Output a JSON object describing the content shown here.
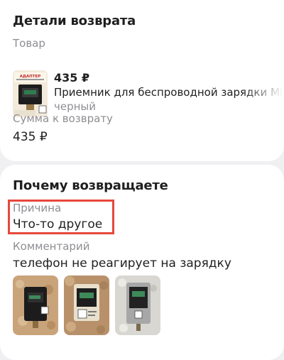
{
  "return_details": {
    "title": "Детали возврата",
    "product_label": "Товар",
    "product": {
      "price": "435 ₽",
      "name": "Приемник для беспроводной зарядки Mi",
      "variant": "черный",
      "thumb_caption": "АДАПТЕР"
    },
    "refund_label": "Сумма к возврату",
    "refund_amount": "435 ₽"
  },
  "why_return": {
    "title": "Почему возвращаете",
    "reason_label": "Причина",
    "reason_value": "Что-то другое",
    "comment_label": "Комментарий",
    "comment_value": "телефон не реагирует на зарядку",
    "photos": [
      "photo-1",
      "photo-2",
      "photo-3"
    ]
  },
  "colors": {
    "highlight_border": "#e5483b",
    "muted_text": "#8e8e93",
    "page_background": "#f0f0f3"
  }
}
